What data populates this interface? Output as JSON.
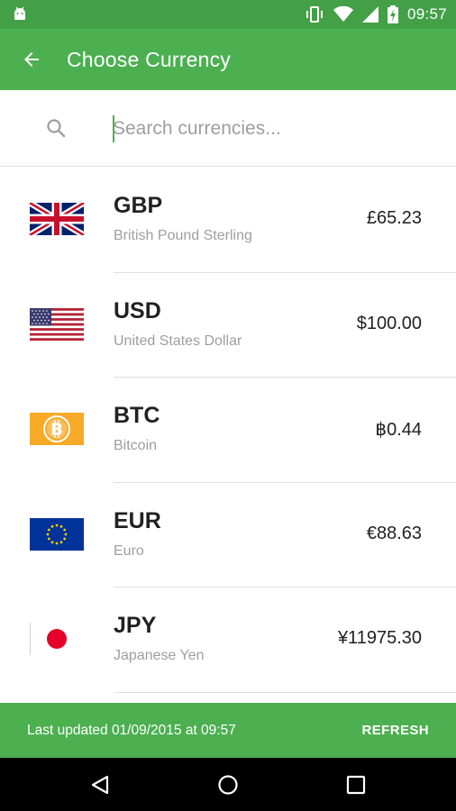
{
  "status_bar": {
    "time": "09:57"
  },
  "app_bar": {
    "title": "Choose Currency"
  },
  "search": {
    "placeholder": "Search currencies...",
    "value": ""
  },
  "currencies": [
    {
      "code": "GBP",
      "name": "British Pound Sterling",
      "amount": "£65.23",
      "flag": "uk-flag-icon"
    },
    {
      "code": "USD",
      "name": "United States Dollar",
      "amount": "$100.00",
      "flag": "us-flag-icon"
    },
    {
      "code": "BTC",
      "name": "Bitcoin",
      "amount": "฿0.44",
      "flag": "bitcoin-flag-icon"
    },
    {
      "code": "EUR",
      "name": "Euro",
      "amount": "€88.63",
      "flag": "eu-flag-icon"
    },
    {
      "code": "JPY",
      "name": "Japanese Yen",
      "amount": "¥11975.30",
      "flag": "japan-flag-icon"
    }
  ],
  "footer": {
    "last_updated": "Last updated 01/09/2015 at 09:57",
    "refresh_label": "REFRESH"
  },
  "colors": {
    "primary": "#4caf50",
    "primary_dark": "#43a047",
    "accent_text": "#212121",
    "secondary_text": "#9e9e9e"
  }
}
